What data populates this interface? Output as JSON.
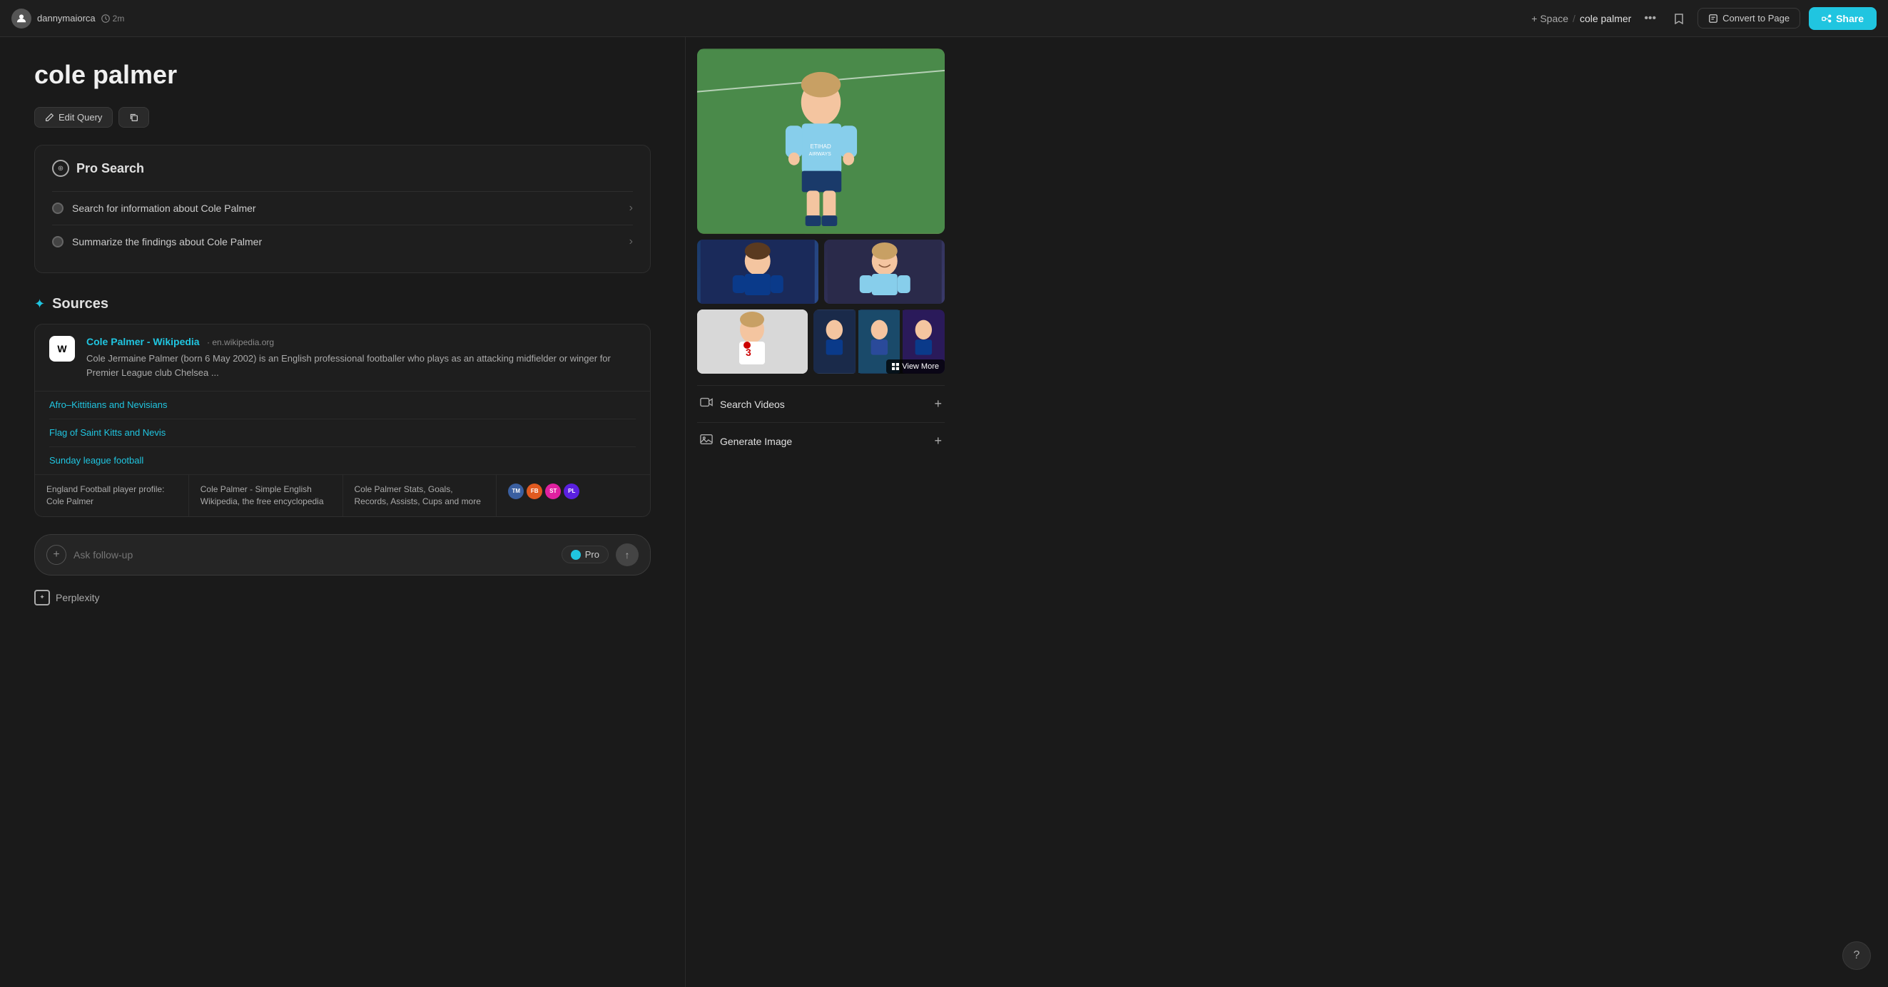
{
  "app": {
    "title": "Perplexity"
  },
  "nav": {
    "username": "dannymaiorca",
    "time_ago": "2m",
    "space_label": "+ Space",
    "slash": "/",
    "page_title": "cole palmer",
    "more_icon": "•••",
    "bookmark_icon": "bookmark",
    "convert_btn_label": "Convert to Page",
    "share_btn_label": "Share"
  },
  "main": {
    "page_heading": "cole palmer",
    "edit_query_label": "Edit Query",
    "copy_icon": "copy"
  },
  "pro_search": {
    "title": "Pro Search",
    "steps": [
      {
        "text": "Search for information about Cole Palmer"
      },
      {
        "text": "Summarize the findings about Cole Palmer"
      }
    ]
  },
  "sources": {
    "section_title": "Sources",
    "main_source": {
      "favicon": "W",
      "name": "Cole Palmer - Wikipedia",
      "domain": "· en.wikipedia.org",
      "description": "Cole Jermaine Palmer (born 6 May 2002) is an English professional footballer who plays as an attacking midfielder or winger for Premier League club Chelsea ..."
    },
    "sub_sources": [
      {
        "label": "Afro–Kittitians and Nevisians"
      },
      {
        "label": "Flag of Saint Kitts and Nevis"
      },
      {
        "label": "Sunday league football"
      }
    ],
    "card_sources": [
      {
        "label": "England Football player profile: Cole Palmer"
      },
      {
        "label": "Cole Palmer - Simple English Wikipedia, the free encyclopedia"
      },
      {
        "label": "Cole Palmer Stats, Goals, Records, Assists, Cups and more"
      },
      {
        "label": "icons",
        "icons": [
          "TM",
          "FB",
          "ST",
          "PL"
        ]
      }
    ]
  },
  "right_panel": {
    "images": {
      "main_alt": "Cole Palmer in Manchester City blue kit",
      "small1_alt": "Cole Palmer in Chelsea blue kit",
      "small2_alt": "Cole Palmer smiling in Manchester City kit",
      "med_alt": "Cole Palmer in England white kit",
      "view_more_label": "View More"
    },
    "search_videos_label": "Search Videos",
    "generate_image_label": "Generate Image"
  },
  "followup": {
    "placeholder": "Ask follow-up",
    "pro_label": "Pro"
  },
  "footer": {
    "brand": "Perplexity"
  }
}
